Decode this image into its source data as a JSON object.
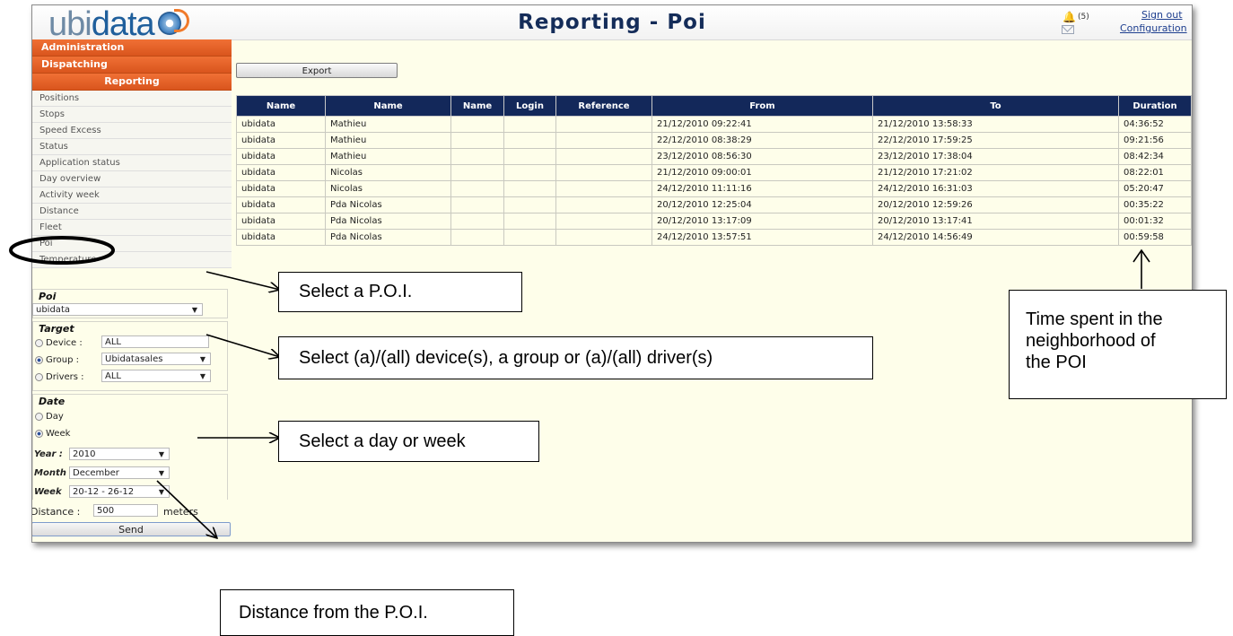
{
  "header": {
    "logo_prefix": "ubi",
    "logo_suffix": "data",
    "title": "Reporting - Poi",
    "notification_count": "(5)",
    "sign_out": "Sign out",
    "configuration": "Configuration"
  },
  "sidebar": {
    "main_menu": [
      "Administration",
      "Dispatching",
      "Reporting"
    ],
    "items": [
      {
        "label": "Positions"
      },
      {
        "label": "Stops"
      },
      {
        "label": "Speed Excess"
      },
      {
        "label": "Status"
      },
      {
        "label": "Application status"
      },
      {
        "label": "Day overview"
      },
      {
        "label": "Activity week"
      },
      {
        "label": "Distance"
      },
      {
        "label": "Fleet"
      },
      {
        "label": "Poi"
      },
      {
        "label": "Temperature"
      }
    ]
  },
  "filters": {
    "poi": {
      "title": "Poi",
      "value": "ubidata"
    },
    "target": {
      "title": "Target",
      "device_label": "Device :",
      "device_value": "ALL",
      "group_label": "Group :",
      "group_value": "Ubidatasales",
      "drivers_label": "Drivers :",
      "drivers_value": "ALL"
    },
    "date": {
      "title": "Date",
      "day_label": "Day",
      "week_label": "Week",
      "year_label": "Year :",
      "year_value": "2010",
      "month_label": "Month",
      "month_value": "December",
      "week_field_label": "Week",
      "week_value": "20-12 - 26-12"
    },
    "distance_label": "Distance :",
    "distance_value": "500",
    "distance_unit": "meters",
    "send_label": "Send"
  },
  "toolbar": {
    "export_label": "Export"
  },
  "table": {
    "columns": [
      "Name",
      "Name",
      "Name",
      "Login",
      "Reference",
      "From",
      "To",
      "Duration"
    ],
    "rows": [
      [
        "ubidata",
        "Mathieu",
        "",
        "",
        "",
        "21/12/2010 09:22:41",
        "21/12/2010 13:58:33",
        "04:36:52"
      ],
      [
        "ubidata",
        "Mathieu",
        "",
        "",
        "",
        "22/12/2010 08:38:29",
        "22/12/2010 17:59:25",
        "09:21:56"
      ],
      [
        "ubidata",
        "Mathieu",
        "",
        "",
        "",
        "23/12/2010 08:56:30",
        "23/12/2010 17:38:04",
        "08:42:34"
      ],
      [
        "ubidata",
        "Nicolas",
        "",
        "",
        "",
        "21/12/2010 09:00:01",
        "21/12/2010 17:21:02",
        "08:22:01"
      ],
      [
        "ubidata",
        "Nicolas",
        "",
        "",
        "",
        "24/12/2010 11:11:16",
        "24/12/2010 16:31:03",
        "05:20:47"
      ],
      [
        "ubidata",
        "Pda Nicolas",
        "",
        "",
        "",
        "20/12/2010 12:25:04",
        "20/12/2010 12:59:26",
        "00:35:22"
      ],
      [
        "ubidata",
        "Pda Nicolas",
        "",
        "",
        "",
        "20/12/2010 13:17:09",
        "20/12/2010 13:17:41",
        "00:01:32"
      ],
      [
        "ubidata",
        "Pda Nicolas",
        "",
        "",
        "",
        "24/12/2010 13:57:51",
        "24/12/2010 14:56:49",
        "00:59:58"
      ]
    ]
  },
  "annotations": {
    "select_poi": "Select a P.O.I.",
    "select_target": "Select (a)/(all) device(s), a group or (a)/(all) driver(s)",
    "time_spent_1": "Time spent in the",
    "time_spent_2": "neighborhood of",
    "time_spent_3": "the POI",
    "select_date": "Select a day or week",
    "distance_from": "Distance from the P.O.I."
  }
}
